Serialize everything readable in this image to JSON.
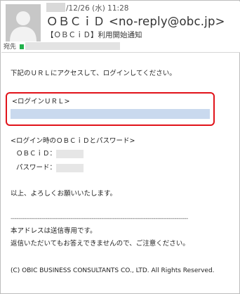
{
  "header": {
    "date": "/12/26 (水) 11:28",
    "from": "ＯＢＣｉＤ <no-reply@obc.jp>",
    "subject": "【ＯＢＣｉＤ】利用開始通知",
    "to_label": "宛先"
  },
  "body": {
    "intro": "下記のＵＲＬにアクセスして、ログインしてください。",
    "url_label": "<ログインＵＲＬ>",
    "cred_title": "<ログイン時のＯＢＣｉＤとパスワード>",
    "id_label": "ＯＢＣｉＤ：",
    "pw_label": "パスワード：",
    "regards": "以上、よろしくお願いいたします。",
    "dashes": "--------------------------------------------------------------------------------------------",
    "note1": "本アドレスは送信専用です。",
    "note2": "返信いただいてもお答えできませんので、ご注意ください。",
    "copyright": "(C) OBIC BUSINESS CONSULTANTS CO., LTD. All Rights Reserved."
  },
  "colors": {
    "highlight_border": "#e1131a",
    "redacted_url": "#c9d9ee",
    "recipient_dot": "#22b14c"
  },
  "icons": {
    "avatar": "person-silhouette-icon"
  }
}
